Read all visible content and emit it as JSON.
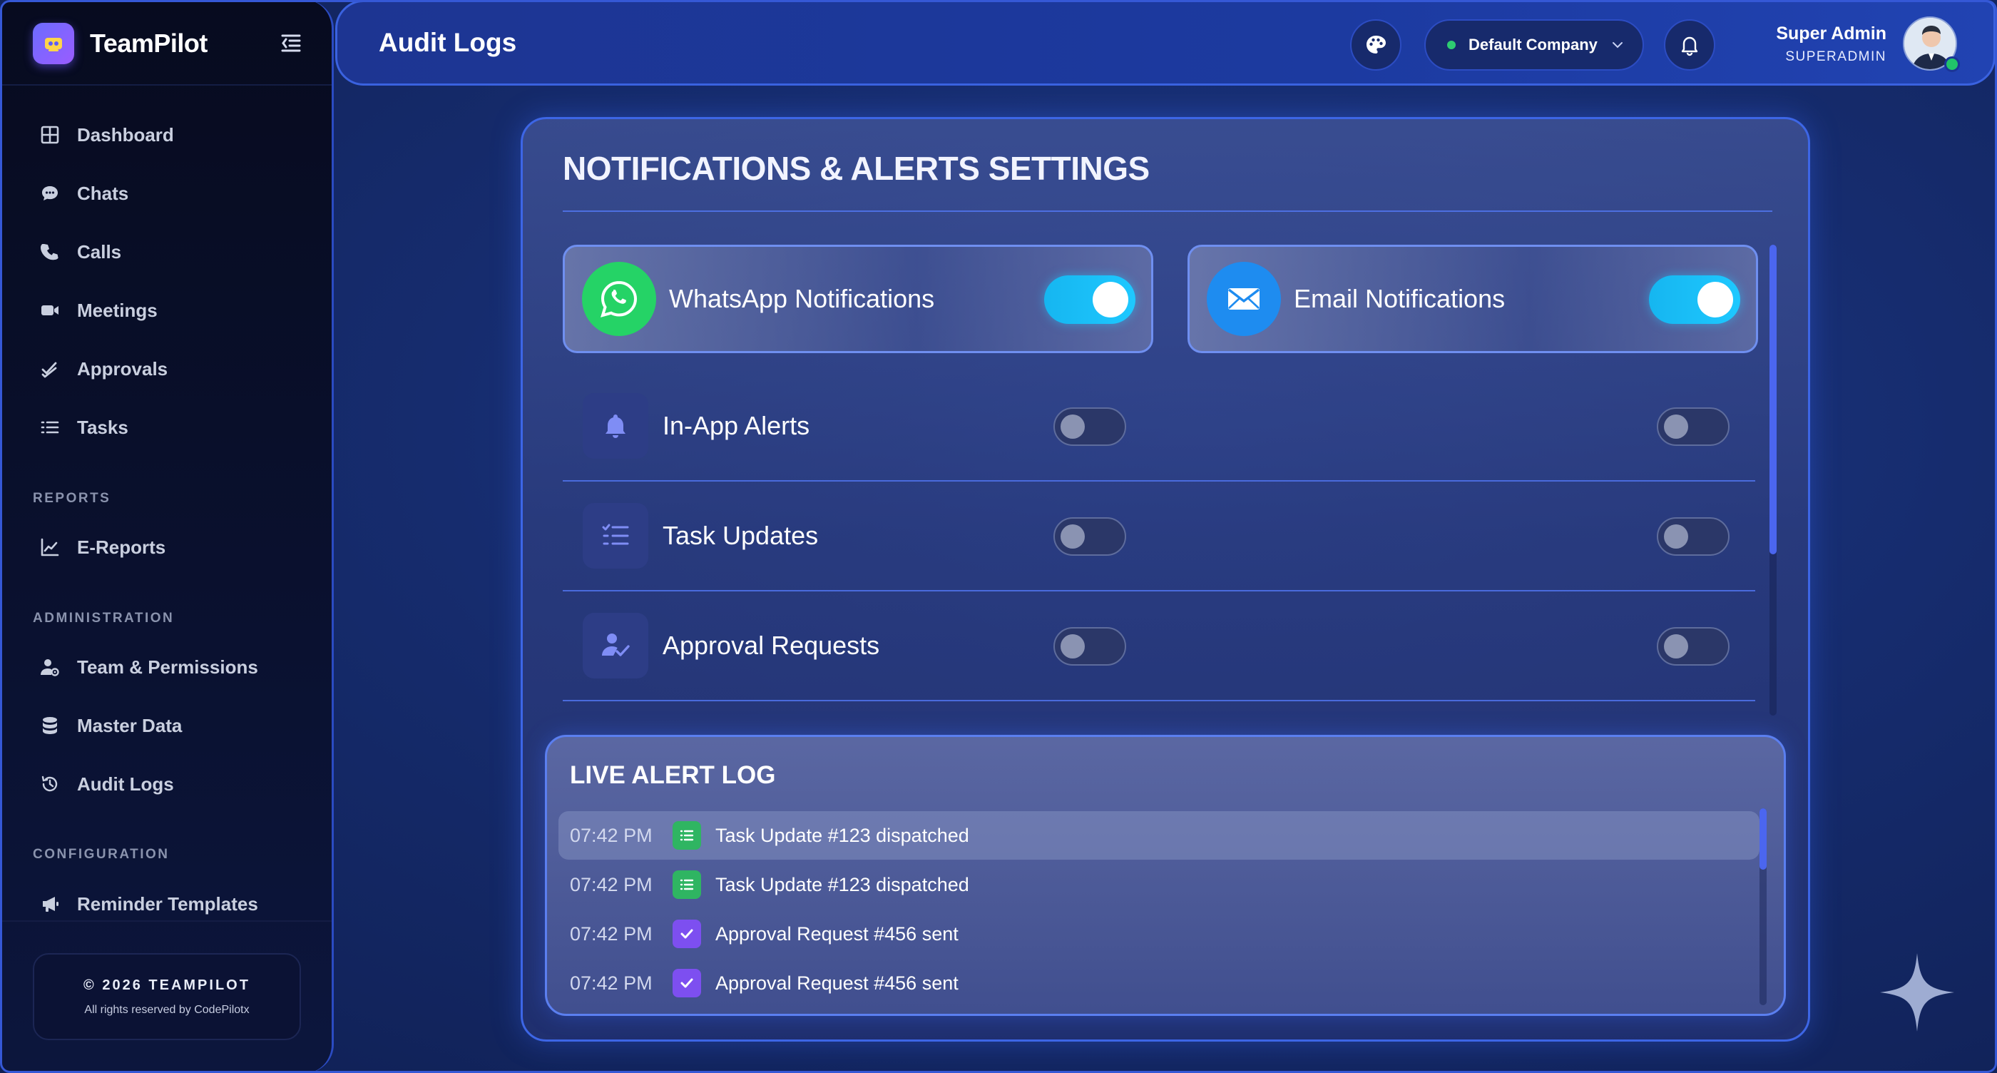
{
  "brand": {
    "name": "TeamPilot"
  },
  "sidebar": {
    "main_items": [
      {
        "label": "Dashboard",
        "icon": "dashboard-grid-icon"
      },
      {
        "label": "Chats",
        "icon": "chat-bubble-icon"
      },
      {
        "label": "Calls",
        "icon": "phone-icon"
      },
      {
        "label": "Meetings",
        "icon": "video-camera-icon"
      },
      {
        "label": "Approvals",
        "icon": "double-check-icon"
      },
      {
        "label": "Tasks",
        "icon": "list-icon"
      }
    ],
    "sections": {
      "reports": {
        "label": "REPORTS",
        "items": [
          {
            "label": "E-Reports",
            "icon": "line-chart-icon"
          }
        ]
      },
      "administration": {
        "label": "ADMINISTRATION",
        "items": [
          {
            "label": "Team & Permissions",
            "icon": "user-gear-icon"
          },
          {
            "label": "Master Data",
            "icon": "database-icon"
          },
          {
            "label": "Audit Logs",
            "icon": "history-icon"
          }
        ]
      },
      "configuration": {
        "label": "CONFIGURATION",
        "items": [
          {
            "label": "Reminder Templates",
            "icon": "megaphone-icon"
          }
        ]
      }
    },
    "footer": {
      "copyright": "© 2026 TEAMPILOT",
      "rights": "All rights reserved by CodePilotx"
    }
  },
  "header": {
    "title": "Audit Logs",
    "company": {
      "name": "Default Company",
      "status_color": "#2ecc71"
    },
    "user": {
      "name": "Super Admin",
      "role": "SUPERADMIN"
    }
  },
  "settings": {
    "title": "NOTIFICATIONS & ALERTS SETTINGS",
    "channels": [
      {
        "label": "WhatsApp Notifications",
        "enabled": true,
        "icon": "whatsapp-icon",
        "color": "#25d366"
      },
      {
        "label": "Email Notifications",
        "enabled": true,
        "icon": "envelope-icon",
        "color": "#1e8cf0"
      }
    ],
    "rows": [
      {
        "label": "In-App Alerts",
        "icon": "bell-icon",
        "whatsapp": false,
        "email": false
      },
      {
        "label": "Task Updates",
        "icon": "task-list-icon",
        "whatsapp": false,
        "email": false
      },
      {
        "label": "Approval Requests",
        "icon": "user-check-icon",
        "whatsapp": false,
        "email": false
      }
    ]
  },
  "log": {
    "title": "LIVE ALERT LOG",
    "entries": [
      {
        "time": "07:42 PM",
        "text": "Task Update #123 dispatched",
        "type": "task",
        "color": "#2fb562"
      },
      {
        "time": "07:42 PM",
        "text": "Task Update #123 dispatched",
        "type": "task",
        "color": "#2fb562"
      },
      {
        "time": "07:42 PM",
        "text": "Approval Request #456 sent",
        "type": "approval",
        "color": "#7d4ff0"
      },
      {
        "time": "07:42 PM",
        "text": "Approval Request #456 sent",
        "type": "approval",
        "color": "#7d4ff0"
      }
    ]
  },
  "colors": {
    "accent": "#3a62e0",
    "toggle_on": "#1ec8ff",
    "background": "#1f3a8a"
  }
}
